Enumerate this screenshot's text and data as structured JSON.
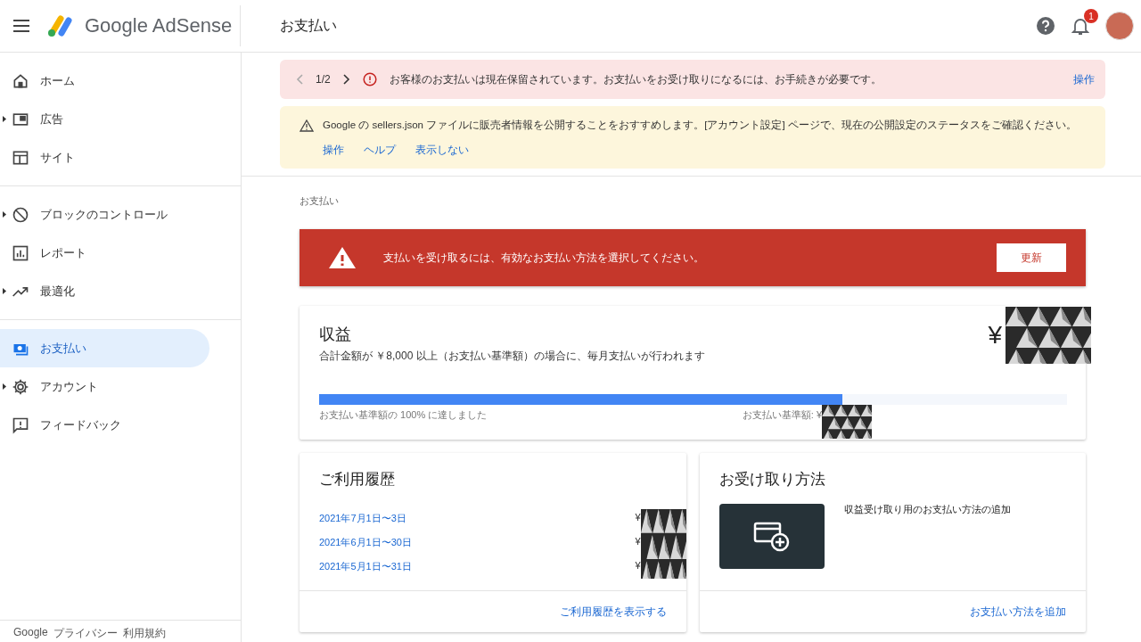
{
  "header": {
    "product": "Google AdSense",
    "page_title": "お支払い",
    "notification_count": "1"
  },
  "sidebar": {
    "sections": [
      [
        {
          "label": "ホーム",
          "selected": false,
          "expandable": false
        },
        {
          "label": "広告",
          "selected": false,
          "expandable": true
        },
        {
          "label": "サイト",
          "selected": false,
          "expandable": false
        }
      ],
      [
        {
          "label": "ブロックのコントロール",
          "selected": false,
          "expandable": true
        },
        {
          "label": "レポート",
          "selected": false,
          "expandable": false
        },
        {
          "label": "最適化",
          "selected": false,
          "expandable": true
        }
      ],
      [
        {
          "label": "お支払い",
          "selected": true,
          "expandable": false
        },
        {
          "label": "アカウント",
          "selected": false,
          "expandable": true
        },
        {
          "label": "フィードバック",
          "selected": false,
          "expandable": false
        }
      ]
    ],
    "footer_links": [
      "Google",
      "プライバシー",
      "利用規約"
    ]
  },
  "alerts": [
    {
      "kind": "error",
      "pager": "1/2",
      "message": "お客様のお支払いは現在保留されています。お支払いをお受け取りになるには、お手続きが必要です。",
      "actions": [
        "操作"
      ]
    },
    {
      "kind": "warning",
      "message": "Google の sellers.json ファイルに販売者情報を公開することをおすすめします。[アカウント設定] ページで、現在の公開設定のステータスをご確認ください。",
      "actions": [
        "操作",
        "ヘルプ",
        "表示しない"
      ]
    }
  ],
  "breadcrumb": "お支払い",
  "banner": {
    "message": "支払いを受け取るには、有効なお支払い方法を選択してください。",
    "button": "更新"
  },
  "earnings": {
    "title": "収益",
    "description": "合計金額が ￥8,000 以上（お支払い基準額）の場合に、毎月支払いが行われます",
    "currency": "¥",
    "level": 0.7,
    "progress_caption": "お支払い基準額の 100% に達しました",
    "threshold_label": "お支払い基準額: ¥"
  },
  "history": {
    "title": "ご利用履歴",
    "rows": [
      {
        "date": "2021年7月1日〜3日",
        "currency": "¥"
      },
      {
        "date": "2021年6月1日〜30日",
        "currency": "¥"
      },
      {
        "date": "2021年5月1日〜31日",
        "currency": "¥"
      }
    ],
    "link": "ご利用履歴を表示する"
  },
  "payment_method": {
    "title": "お受け取り方法",
    "description": "収益受け取り用のお支払い方法の追加",
    "link": "お支払い方法を追加"
  }
}
